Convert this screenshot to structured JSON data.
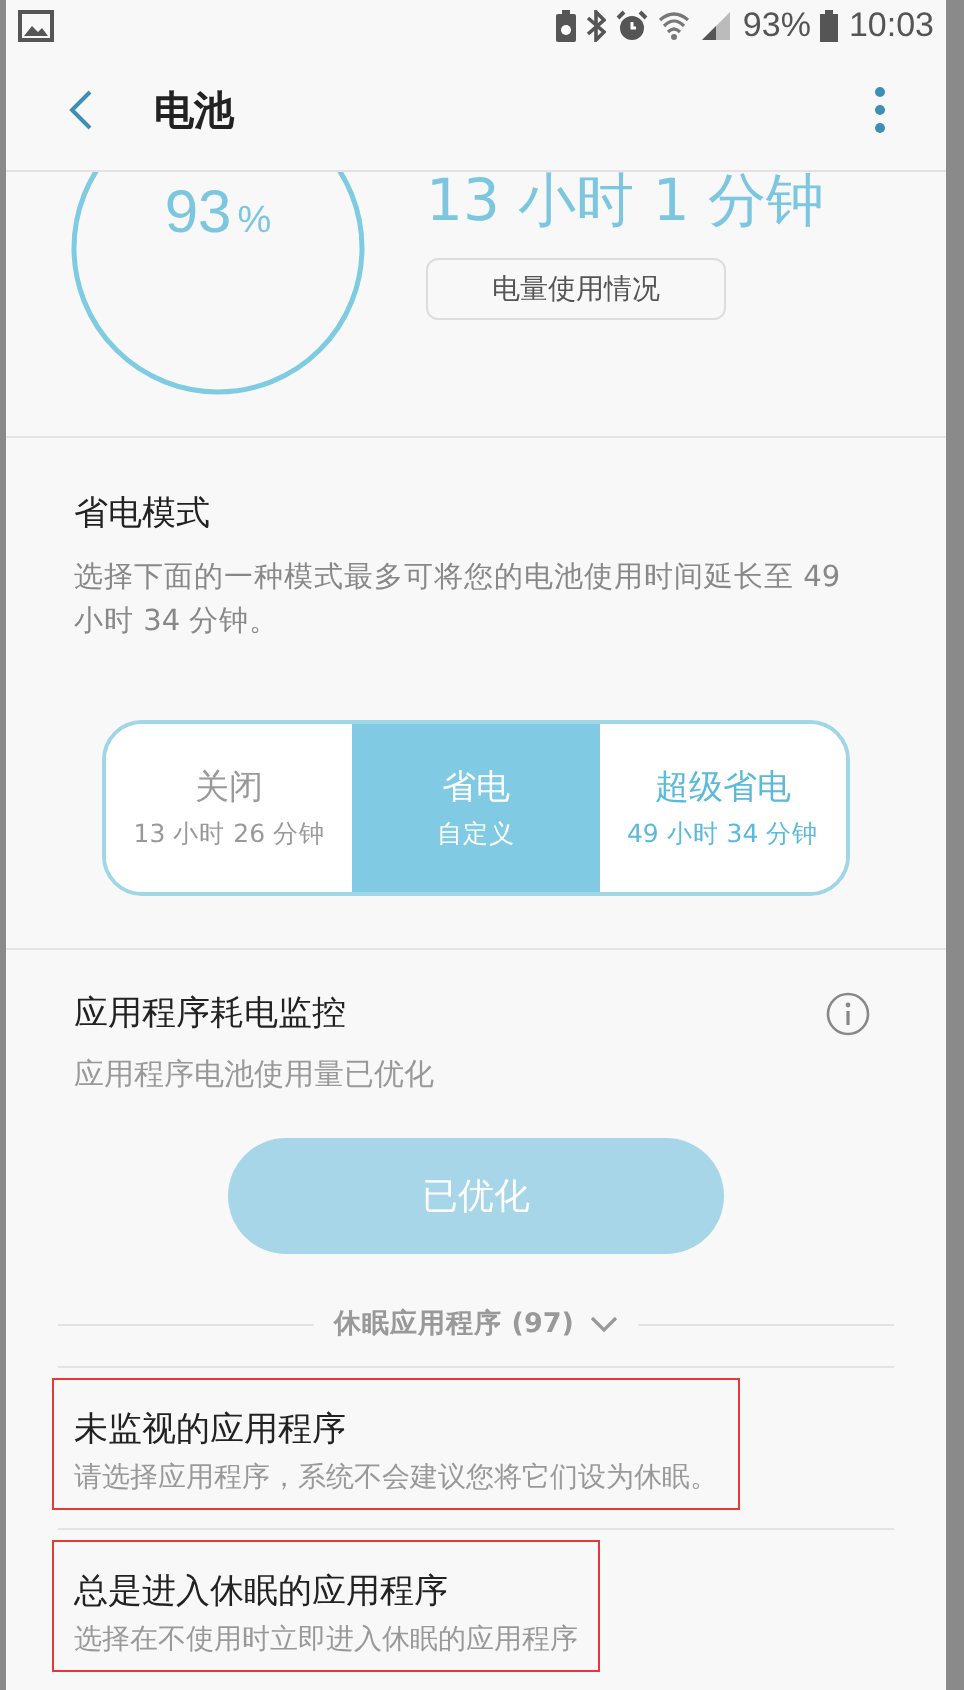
{
  "status_bar": {
    "battery_text": "93%",
    "time": "10:03"
  },
  "header": {
    "title": "电池"
  },
  "summary": {
    "percent": "93",
    "percent_unit": "%",
    "remaining": "13 小时 1 分钟",
    "usage_button": "电量使用情况"
  },
  "power_saving": {
    "title": "省电模式",
    "description": "选择下面的一种模式最多可将您的电池使用时间延长至 49 小时 34 分钟。",
    "modes": [
      {
        "label": "关闭",
        "detail": "13 小时 26 分钟",
        "selected": false
      },
      {
        "label": "省电",
        "detail": "自定义",
        "selected": true
      },
      {
        "label": "超级省电",
        "detail": "49 小时 34 分钟",
        "selected": false
      }
    ]
  },
  "app_monitor": {
    "title": "应用程序耗电监控",
    "subtitle": "应用程序电池使用量已优化",
    "button": {
      "label": "已优化",
      "disabled": true
    }
  },
  "sleeping_apps": {
    "label": "休眠应用程序 (97)",
    "expanded": false
  },
  "items": [
    {
      "title": "未监视的应用程序",
      "subtitle": "请选择应用程序，系统不会建议您将它们设为休眠。",
      "highlighted": true
    },
    {
      "title": "总是进入休眠的应用程序",
      "subtitle": "选择在不使用时立即进入休眠的应用程序",
      "highlighted": true
    }
  ]
}
